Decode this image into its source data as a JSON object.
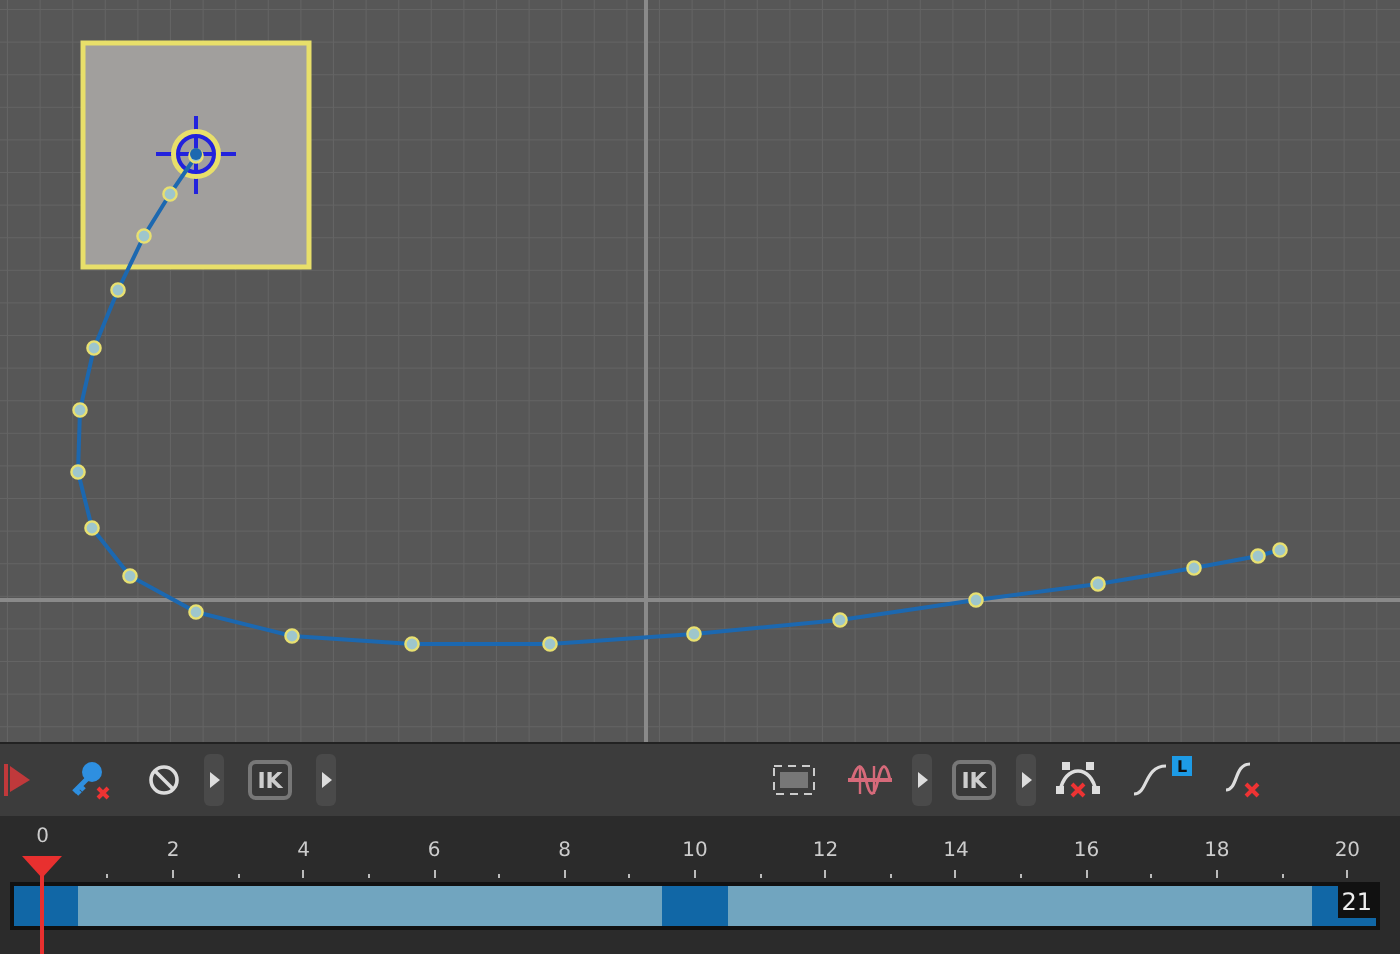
{
  "toolbar": {
    "left": [
      {
        "kind": "flag"
      },
      {
        "kind": "key-delete"
      },
      {
        "kind": "no-entry"
      },
      {
        "kind": "expander"
      },
      {
        "kind": "ik",
        "label": "IK"
      },
      {
        "kind": "expander"
      }
    ],
    "right": [
      {
        "kind": "frame-select"
      },
      {
        "kind": "wave"
      },
      {
        "kind": "expander"
      },
      {
        "kind": "ik",
        "label": "IK"
      },
      {
        "kind": "expander"
      },
      {
        "kind": "curve-delete"
      },
      {
        "kind": "curve-linear",
        "badge": "L"
      },
      {
        "kind": "curve-clear"
      }
    ]
  },
  "timeline": {
    "end_frame": "21",
    "frames": [
      {
        "label": "0",
        "key": true,
        "current": true
      },
      {
        "key": false,
        "current": false
      },
      {
        "label": "2",
        "key": false,
        "current": false
      },
      {
        "key": false,
        "current": false
      },
      {
        "label": "4",
        "key": false,
        "current": false
      },
      {
        "key": false,
        "current": false
      },
      {
        "label": "6",
        "key": false,
        "current": false
      },
      {
        "key": false,
        "current": false
      },
      {
        "label": "8",
        "key": false,
        "current": false
      },
      {
        "key": false,
        "current": false
      },
      {
        "label": "10",
        "key": true,
        "current": false
      },
      {
        "key": false,
        "current": false
      },
      {
        "label": "12",
        "key": false,
        "current": false
      },
      {
        "key": false,
        "current": false
      },
      {
        "label": "14",
        "key": false,
        "current": false
      },
      {
        "key": false,
        "current": false
      },
      {
        "label": "16",
        "key": false,
        "current": false
      },
      {
        "key": false,
        "current": false
      },
      {
        "label": "18",
        "key": false,
        "current": false
      },
      {
        "key": false,
        "current": false
      },
      {
        "label": "20",
        "key": true,
        "current": false
      }
    ]
  }
}
